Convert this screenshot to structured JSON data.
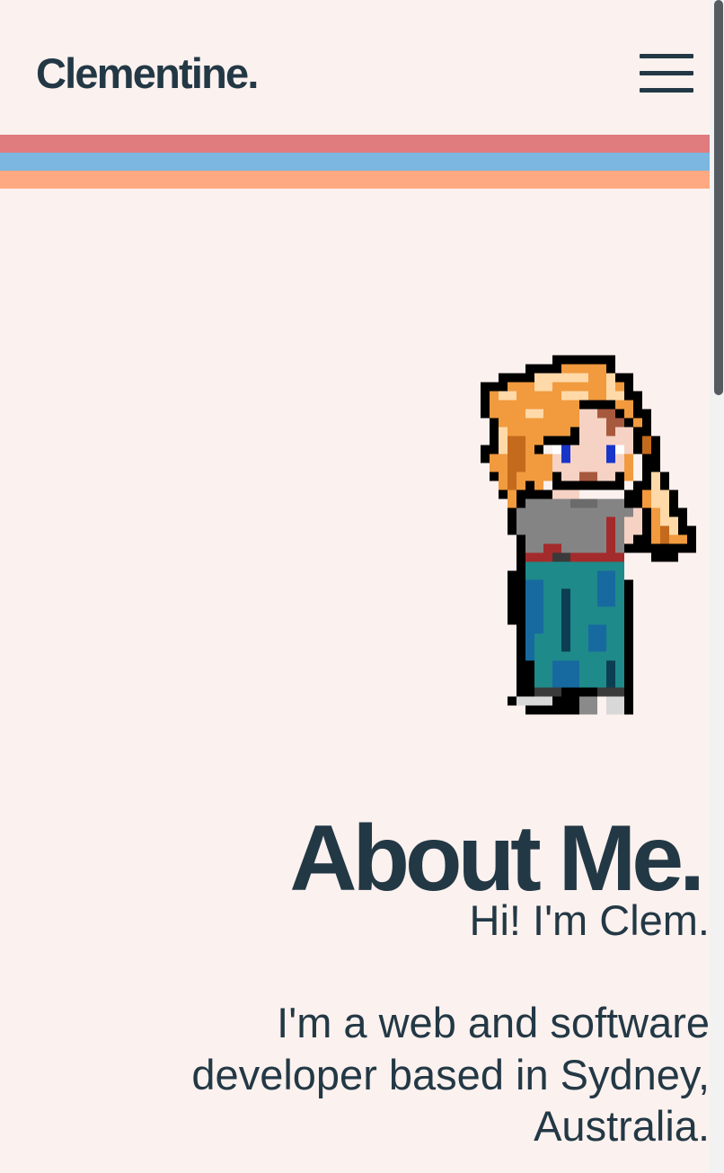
{
  "header": {
    "brand": "Clementine.",
    "menu_icon": "hamburger-menu-icon"
  },
  "stripes": {
    "colors": [
      "#e07b7e",
      "#7bb7e0",
      "#fea982"
    ]
  },
  "hero": {
    "image": "pixel-art-character-image",
    "title": "About Me.",
    "greeting": "Hi! I'm Clem.",
    "bio": "I'm a web and software developer based in Sydney, Australia."
  }
}
